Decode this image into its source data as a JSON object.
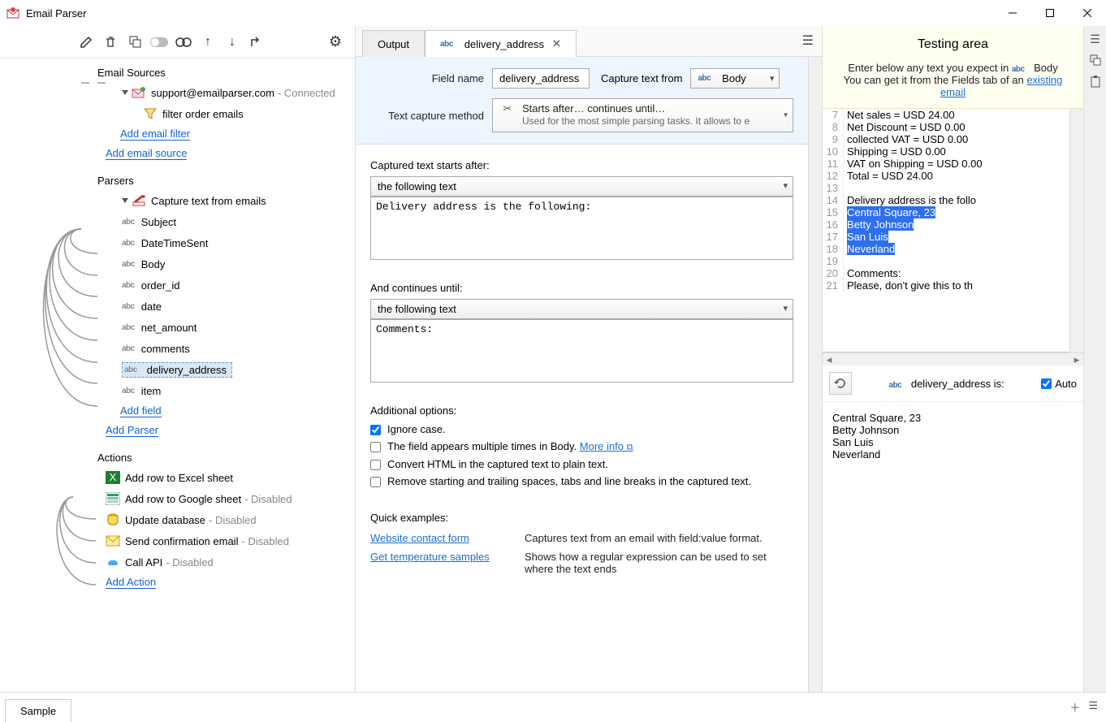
{
  "app_title": "Email Parser",
  "sidebar": {
    "sections": {
      "email_sources": {
        "title": "Email Sources",
        "source": {
          "label": "support@emailparser.com",
          "status": "- Connected"
        },
        "filter": {
          "label": "filter order emails"
        },
        "add_filter": "Add email filter",
        "add_source": "Add email source"
      },
      "parsers": {
        "title": "Parsers",
        "parser": {
          "label": "Capture text from emails"
        },
        "fields": [
          "Subject",
          "DateTimeSent",
          "Body",
          "order_id",
          "date",
          "net_amount",
          "comments",
          "delivery_address",
          "item"
        ],
        "add_field": "Add field",
        "add_parser": "Add Parser"
      },
      "actions": {
        "title": "Actions",
        "items": [
          {
            "label": "Add row to Excel sheet",
            "status": ""
          },
          {
            "label": "Add row to Google sheet",
            "status": "- Disabled"
          },
          {
            "label": "Update database",
            "status": "- Disabled"
          },
          {
            "label": "Send confirmation email",
            "status": "- Disabled"
          },
          {
            "label": "Call API",
            "status": "- Disabled"
          }
        ],
        "add_action": "Add Action"
      }
    }
  },
  "tabs": {
    "output": "Output",
    "field_tab": "delivery_address"
  },
  "form": {
    "field_name_label": "Field name",
    "field_name_value": "delivery_address",
    "capture_from_label": "Capture text from",
    "capture_from_value": "Body",
    "method_label": "Text capture method",
    "method_title": "Starts after… continues until…",
    "method_sub": "Used for the most simple parsing tasks. It allows to e"
  },
  "starts": {
    "label": "Captured text starts after:",
    "mode": "the following text",
    "value": "Delivery address is the following:"
  },
  "continues": {
    "label": "And continues until:",
    "mode": "the following text",
    "value": "Comments:"
  },
  "options": {
    "header": "Additional options:",
    "ignore": "Ignore case.",
    "multiple_pre": "The field appears multiple times in Body. ",
    "more_info": "More info",
    "convert_html": "Convert HTML in the captured text to plain text.",
    "trim": "Remove starting and trailing spaces, tabs and line breaks in the captured text."
  },
  "examples": {
    "header": "Quick examples:",
    "rows": [
      {
        "link": "Website contact form",
        "desc": "Captures text from an email with field:value format."
      },
      {
        "link": "Get temperature samples",
        "desc": "Shows how a regular expression can be used to set where the text ends"
      }
    ]
  },
  "testing": {
    "title": "Testing area",
    "line1_pre": "Enter below any text you expect in ",
    "line1_field": "Body",
    "line2_pre": "You can get it from the Fields tab of an ",
    "line2_link": "existing email",
    "code": [
      {
        "n": 7,
        "t": "Net sales = USD 24.00"
      },
      {
        "n": 8,
        "t": "Net Discount = USD 0.00"
      },
      {
        "n": 9,
        "t": "collected VAT = USD 0.00"
      },
      {
        "n": 10,
        "t": "Shipping = USD 0.00"
      },
      {
        "n": 11,
        "t": "VAT on Shipping = USD 0.00"
      },
      {
        "n": 12,
        "t": "Total = USD 24.00"
      },
      {
        "n": 13,
        "t": ""
      },
      {
        "n": 14,
        "t": "Delivery address is the follo"
      },
      {
        "n": 15,
        "t": "Central Square, 23",
        "hl": true
      },
      {
        "n": 16,
        "t": "Betty Johnson",
        "hl": true
      },
      {
        "n": 17,
        "t": "San Luis",
        "hl": true
      },
      {
        "n": 18,
        "t": "Neverland",
        "hl": true
      },
      {
        "n": 19,
        "t": ""
      },
      {
        "n": 20,
        "t": "Comments:"
      },
      {
        "n": 21,
        "t": "Please, don't give this to th"
      }
    ],
    "result_field": "delivery_address",
    "result_suffix": " is:",
    "auto": "Auto",
    "result_text": "Central Square, 23\nBetty Johnson\nSan Luis\nNeverland"
  },
  "bottom": {
    "tab": "Sample"
  }
}
